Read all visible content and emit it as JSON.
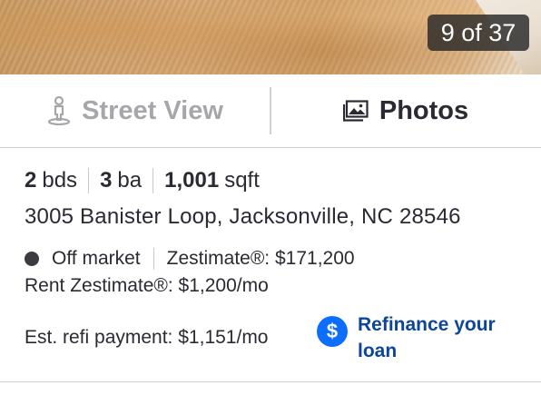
{
  "photo": {
    "counter": "9 of 37"
  },
  "view_tabs": {
    "street_view": "Street View",
    "photos": "Photos"
  },
  "facts": [
    {
      "value": "2",
      "unit": "bds"
    },
    {
      "value": "3",
      "unit": "ba"
    },
    {
      "value": "1,001",
      "unit": "sqft"
    }
  ],
  "address": "3005 Banister Loop, Jacksonville, NC 28546",
  "status": {
    "label": "Off market",
    "zestimate": "Zestimate®: $171,200",
    "rent_zestimate": "Rent Zestimate®: $1,200/mo"
  },
  "refi": {
    "label": "Est. refi payment:",
    "value": "$1,151/mo",
    "link": "Refinance your loan",
    "icon_symbol": "$"
  },
  "colors": {
    "link": "#0d4599",
    "icon_bg": "#0d6efd",
    "muted": "#a7a6ab"
  }
}
